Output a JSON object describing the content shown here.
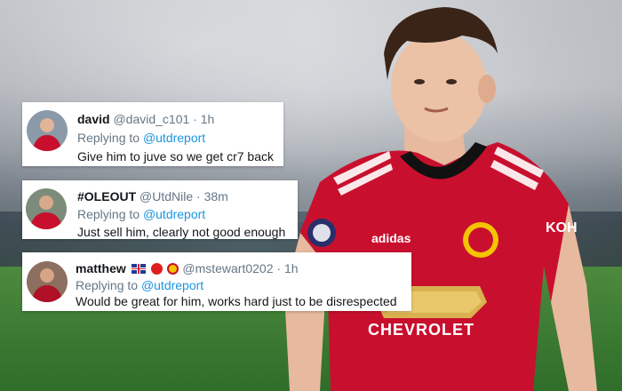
{
  "tweets": [
    {
      "name": "david",
      "handle": "@david_c101",
      "sep": "·",
      "time": "1h",
      "replying_prefix": "Replying to",
      "replying_to": "@utdreport",
      "text": "Give him to juve so we get cr7 back",
      "avatar_icon": "player-avatar-icon"
    },
    {
      "name": "#OLEOUT",
      "handle": "@UtdNile",
      "sep": "·",
      "time": "38m",
      "replying_prefix": "Replying to",
      "replying_to": "@utdreport",
      "text": "Just sell him, clearly not good enough",
      "avatar_icon": "player-avatar-icon"
    },
    {
      "name": "matthew",
      "name_emojis": [
        "uk-flag-icon",
        "red-circle-icon",
        "club-crest-icon"
      ],
      "handle": "@mstewart0202",
      "sep": "·",
      "time": "1h",
      "replying_prefix": "Replying to",
      "replying_to": "@utdreport",
      "text": "Would be great for him, works hard just to be disrespected",
      "avatar_icon": "player-avatar-icon"
    }
  ],
  "shirt": {
    "sponsor": "CHEVROLET",
    "brand": "adidas",
    "sleeve_text": "KOH"
  },
  "colors": {
    "shirt_red": "#c8102e",
    "twitter_blue": "#1b95e0",
    "meta_gray": "#657786"
  }
}
